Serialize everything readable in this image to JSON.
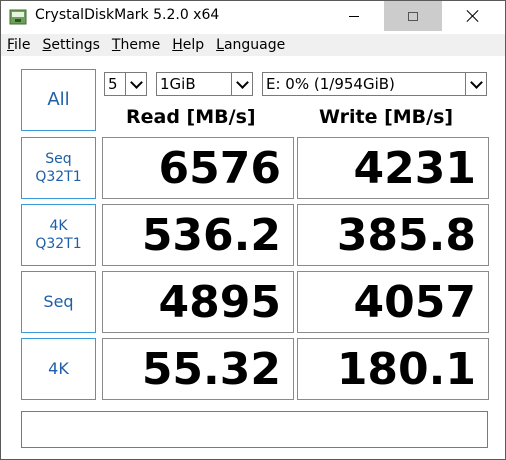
{
  "window": {
    "title": "CrystalDiskMark 5.2.0 x64"
  },
  "menu": {
    "items": [
      {
        "mnemonic": "F",
        "rest": "ile"
      },
      {
        "mnemonic": "S",
        "rest": "ettings"
      },
      {
        "mnemonic": "T",
        "rest": "heme"
      },
      {
        "mnemonic": "H",
        "rest": "elp"
      },
      {
        "mnemonic": "L",
        "rest": "anguage"
      }
    ]
  },
  "controls": {
    "all_label": "All",
    "test_count": "5",
    "test_size": "1GiB",
    "drive": "E: 0% (1/954GiB)"
  },
  "headers": {
    "read": "Read [MB/s]",
    "write": "Write [MB/s]"
  },
  "rows": [
    {
      "label_line1": "Seq",
      "label_line2": "Q32T1",
      "read": "6576",
      "write": "4231"
    },
    {
      "label_line1": "4K",
      "label_line2": "Q32T1",
      "read": "536.2",
      "write": "385.8"
    },
    {
      "label_line1": "Seq",
      "label_line2": "",
      "read": "4895",
      "write": "4057"
    },
    {
      "label_line1": "4K",
      "label_line2": "",
      "read": "55.32",
      "write": "180.1"
    }
  ],
  "status": "",
  "icons": {
    "app": "disk-icon",
    "minimize": "minimize-icon",
    "maximize": "maximize-icon",
    "close": "close-icon"
  },
  "colors": {
    "button_border": "#3b9ad8",
    "button_text": "#1e5fa8",
    "maximize_hover": "#cccccc"
  }
}
